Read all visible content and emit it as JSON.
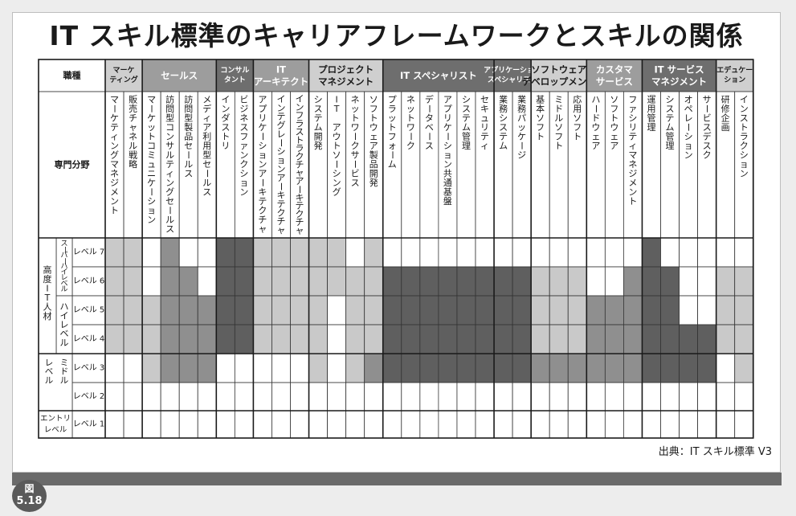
{
  "title": "IT スキル標準のキャリアフレームワークとスキルの関係",
  "figure_label_top": "図",
  "figure_label_bottom": "5.18",
  "source": "出典：IT スキル標準 V3",
  "header_shokushu": "職種",
  "header_senmon": "専門分野",
  "colors": {
    "dark": "#5f5f5f",
    "mid": "#8f8f8f",
    "light": "#c9c9c9",
    "white": "#ffffff",
    "header_light": "#cfcfcf",
    "header_mid": "#9d9d9d",
    "header_dark": "#6e6e6e"
  },
  "level_groups": [
    {
      "label": "高度IT人材",
      "subgroups": [
        {
          "label": "スーパーハイレベル",
          "levels": [
            7,
            6
          ]
        },
        {
          "label": "ハイレベル",
          "levels": [
            5,
            4
          ]
        }
      ]
    },
    {
      "label": "",
      "subgroups": [
        {
          "label": "ミドルレベル",
          "levels": [
            3
          ]
        }
      ]
    },
    {
      "label": "",
      "subgroups": [
        {
          "label": "エントリレベル",
          "levels": [
            1
          ]
        }
      ]
    }
  ],
  "middle_2_label": "",
  "level_labels": [
    "レベル 7",
    "レベル 6",
    "レベル 5",
    "レベル 4",
    "レベル 3",
    "レベル 2",
    "レベル 1"
  ],
  "jobs": [
    {
      "name": "マーケティング",
      "lines": [
        "マーケ",
        "ティング"
      ],
      "shade": "light",
      "specialties": [
        {
          "name": "マーケティングマネジメント",
          "grid": [
            "L",
            "L",
            "L",
            "L",
            "W",
            "W",
            "W"
          ]
        },
        {
          "name": "販売チャネル戦略",
          "grid": [
            "L",
            "L",
            "L",
            "L",
            "W",
            "W",
            "W"
          ]
        }
      ]
    },
    {
      "name": "セールス",
      "lines": [
        "セールス"
      ],
      "shade": "mid",
      "specialties": [
        {
          "name": "マーケットコミュニケーション",
          "grid": [
            "W",
            "W",
            "L",
            "L",
            "L",
            "W",
            "W"
          ]
        },
        {
          "name": "訪問型コンサルティングセールス",
          "grid": [
            "M",
            "M",
            "M",
            "M",
            "M",
            "W",
            "W"
          ]
        },
        {
          "name": "訪問型製品セールス",
          "grid": [
            "W",
            "M",
            "M",
            "M",
            "M",
            "W",
            "W"
          ]
        },
        {
          "name": "メディア利用型セールス",
          "grid": [
            "W",
            "W",
            "M",
            "M",
            "M",
            "W",
            "W"
          ]
        }
      ]
    },
    {
      "name": "コンサルタント",
      "lines": [
        "コンサル",
        "タント"
      ],
      "shade": "dark",
      "specialties": [
        {
          "name": "インダストリ",
          "grid": [
            "D",
            "D",
            "D",
            "D",
            "W",
            "W",
            "W"
          ]
        },
        {
          "name": "ビジネスファンクション",
          "grid": [
            "D",
            "D",
            "D",
            "D",
            "W",
            "W",
            "W"
          ]
        }
      ]
    },
    {
      "name": "IT アーキテクト",
      "lines": [
        "IT",
        "アーキテクト"
      ],
      "shade": "mid",
      "specialties": [
        {
          "name": "アプリケーションアーキテクチャ",
          "grid": [
            "L",
            "L",
            "L",
            "L",
            "W",
            "W",
            "W"
          ]
        },
        {
          "name": "インテグレーションアーキテクチャ",
          "grid": [
            "L",
            "L",
            "L",
            "L",
            "W",
            "W",
            "W"
          ]
        },
        {
          "name": "インフラストラクチャアーキテクチャ",
          "grid": [
            "L",
            "L",
            "L",
            "L",
            "W",
            "W",
            "W"
          ]
        }
      ]
    },
    {
      "name": "プロジェクトマネジメント",
      "lines": [
        "プロジェクト",
        "マネジメント"
      ],
      "shade": "light",
      "specialties": [
        {
          "name": "システム開発",
          "grid": [
            "L",
            "L",
            "L",
            "L",
            "L",
            "W",
            "W"
          ]
        },
        {
          "name": "IT アウトソーシング",
          "grid": [
            "L",
            "L",
            "W",
            "W",
            "W",
            "W",
            "W"
          ]
        },
        {
          "name": "ネットワークサービス",
          "grid": [
            "W",
            "L",
            "L",
            "L",
            "L",
            "W",
            "W"
          ]
        },
        {
          "name": "ソフトウェア製品開発",
          "grid": [
            "L",
            "L",
            "L",
            "L",
            "M",
            "W",
            "W"
          ]
        }
      ]
    },
    {
      "name": "IT スペシャリスト",
      "lines": [
        "IT スペシャリスト"
      ],
      "shade": "dark",
      "specialties": [
        {
          "name": "プラットフォーム",
          "grid": [
            "W",
            "D",
            "D",
            "D",
            "D",
            "W",
            "W"
          ]
        },
        {
          "name": "ネットワーク",
          "grid": [
            "W",
            "D",
            "D",
            "D",
            "D",
            "W",
            "W"
          ]
        },
        {
          "name": "データベース",
          "grid": [
            "W",
            "D",
            "D",
            "D",
            "D",
            "W",
            "W"
          ]
        },
        {
          "name": "アプリケーション共通基盤",
          "grid": [
            "W",
            "D",
            "D",
            "D",
            "D",
            "W",
            "W"
          ]
        },
        {
          "name": "システム管理",
          "grid": [
            "W",
            "D",
            "D",
            "D",
            "D",
            "W",
            "W"
          ]
        },
        {
          "name": "セキュリティ",
          "grid": [
            "W",
            "D",
            "D",
            "D",
            "D",
            "W",
            "W"
          ]
        }
      ]
    },
    {
      "name": "アプリケーションスペシャリスト",
      "lines": [
        "アプリケーション",
        "スペシャリスト"
      ],
      "shade": "dark",
      "specialties": [
        {
          "name": "業務システム",
          "grid": [
            "W",
            "D",
            "D",
            "D",
            "D",
            "W",
            "W"
          ]
        },
        {
          "name": "業務パッケージ",
          "grid": [
            "W",
            "D",
            "D",
            "D",
            "D",
            "W",
            "W"
          ]
        }
      ]
    },
    {
      "name": "ソフトウェアデベロップメント",
      "lines": [
        "ソフトウェア",
        "デベロップメント"
      ],
      "shade": "light",
      "specialties": [
        {
          "name": "基本ソフト",
          "grid": [
            "W",
            "L",
            "L",
            "L",
            "M",
            "W",
            "W"
          ]
        },
        {
          "name": "ミドルソフト",
          "grid": [
            "W",
            "L",
            "L",
            "L",
            "M",
            "W",
            "W"
          ]
        },
        {
          "name": "応用ソフト",
          "grid": [
            "W",
            "L",
            "L",
            "L",
            "M",
            "W",
            "W"
          ]
        }
      ]
    },
    {
      "name": "カスタマサービス",
      "lines": [
        "カスタマ",
        "サービス"
      ],
      "shade": "mid",
      "specialties": [
        {
          "name": "ハードウェア",
          "grid": [
            "W",
            "W",
            "M",
            "M",
            "M",
            "W",
            "W"
          ]
        },
        {
          "name": "ソフトウェア",
          "grid": [
            "W",
            "W",
            "M",
            "M",
            "M",
            "W",
            "W"
          ]
        },
        {
          "name": "ファシリティマネジメント",
          "grid": [
            "W",
            "M",
            "M",
            "M",
            "M",
            "W",
            "W"
          ]
        }
      ]
    },
    {
      "name": "IT サービスマネジメント",
      "lines": [
        "IT サービス",
        "マネジメント"
      ],
      "shade": "dark",
      "specialties": [
        {
          "name": "運用管理",
          "grid": [
            "D",
            "D",
            "D",
            "D",
            "D",
            "W",
            "W"
          ]
        },
        {
          "name": "システム管理",
          "grid": [
            "W",
            "D",
            "D",
            "D",
            "D",
            "W",
            "W"
          ]
        },
        {
          "name": "オペレーション",
          "grid": [
            "W",
            "W",
            "W",
            "D",
            "D",
            "W",
            "W"
          ]
        },
        {
          "name": "サービスデスク",
          "grid": [
            "W",
            "W",
            "W",
            "D",
            "D",
            "W",
            "W"
          ]
        }
      ]
    },
    {
      "name": "エデュケーション",
      "lines": [
        "エデュケー",
        "ション"
      ],
      "shade": "light",
      "specialties": [
        {
          "name": "研修企画",
          "grid": [
            "W",
            "L",
            "L",
            "L",
            "W",
            "W",
            "W"
          ]
        },
        {
          "name": "インストラクション",
          "grid": [
            "W",
            "L",
            "L",
            "L",
            "L",
            "W",
            "W"
          ]
        }
      ]
    }
  ]
}
